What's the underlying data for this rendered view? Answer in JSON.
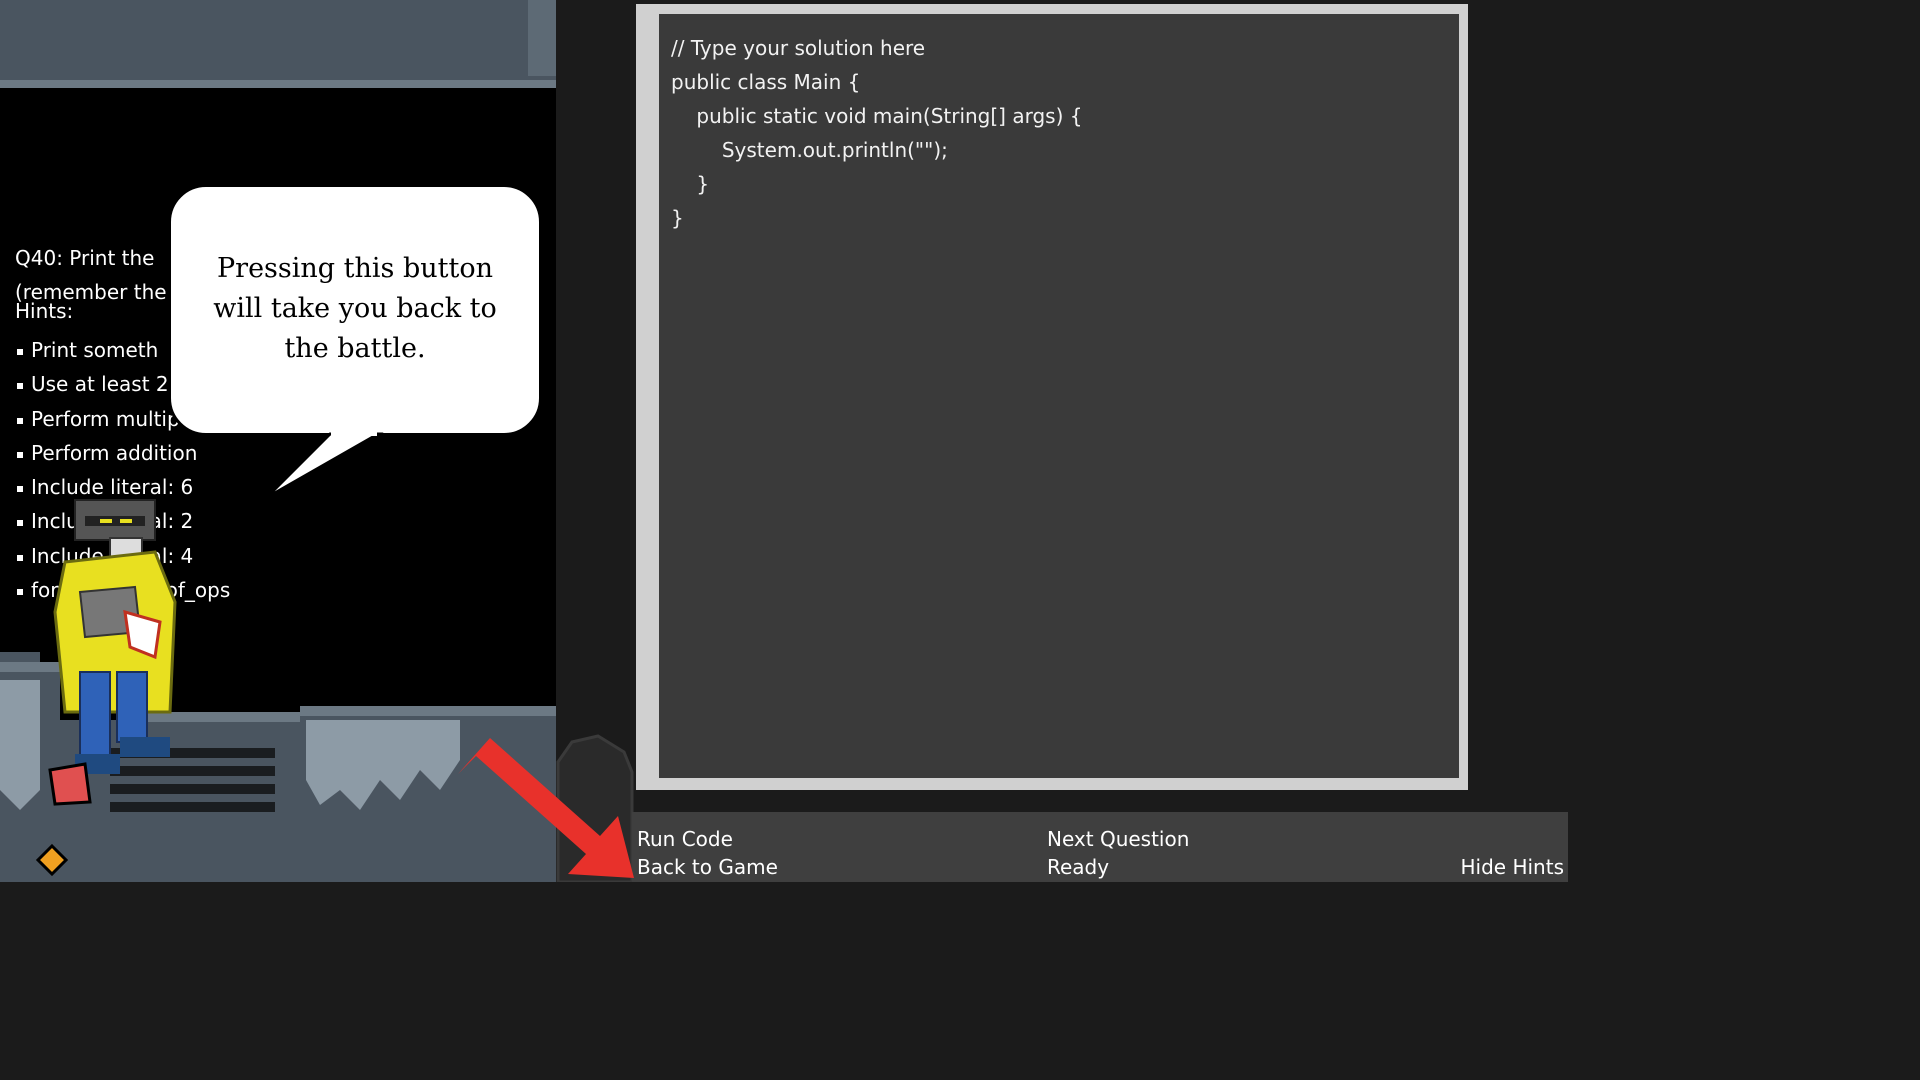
{
  "question": {
    "title": "Q40: Print the",
    "reminder": "(remember the",
    "hints_label": "Hints:",
    "hints": [
      "Print someth",
      "Use at least 2",
      "Perform multip",
      "Perform addition",
      "Include literal: 6",
      "Include literal: 2",
      "Include literal: 4",
      "format: num_of_ops"
    ]
  },
  "tutorial": {
    "bubble_text": "Pressing this button will take you back to the battle."
  },
  "editor": {
    "lines": [
      "// Type your solution here",
      "public class Main {",
      "    public static void main(String[] args) {",
      "        System.out.println(\"\");",
      "    }",
      "}"
    ]
  },
  "buttons": {
    "run_code": "Run Code",
    "back_to_game": "Back to Game",
    "next_question": "Next Question",
    "status": "Ready",
    "hide_hints": "Hide Hints"
  },
  "colors": {
    "editor_bg": "#3a3a3a",
    "editor_frame": "#d0d0d0",
    "arrow": "#e8312b",
    "character_coat": "#e8e020"
  }
}
